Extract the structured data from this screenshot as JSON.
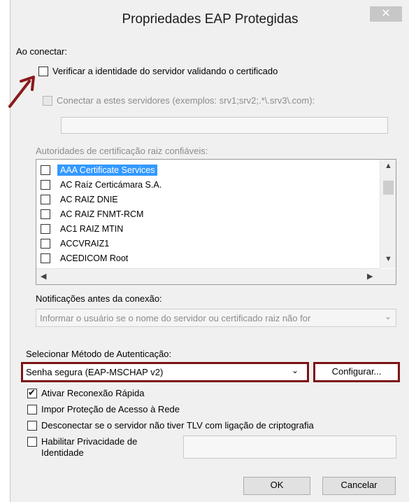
{
  "window": {
    "title": "Propriedades EAP Protegidas",
    "close_glyph": "✕"
  },
  "connect_label": "Ao conectar:",
  "verify_server": {
    "label": "Verificar a identidade do servidor validando o certificado",
    "checked": false
  },
  "connect_servers": {
    "label": "Conectar a estes servidores (exemplos: srv1;srv2;.*\\.srv3\\.com):",
    "checked": false,
    "value": ""
  },
  "trusted_roots": {
    "label": "Autoridades de certificação raiz confiáveis:",
    "items": [
      {
        "label": "AAA Certificate Services",
        "checked": false,
        "selected": true
      },
      {
        "label": "AC Raíz Certicámara S.A.",
        "checked": false,
        "selected": false
      },
      {
        "label": "AC RAIZ DNIE",
        "checked": false,
        "selected": false
      },
      {
        "label": "AC RAIZ FNMT-RCM",
        "checked": false,
        "selected": false
      },
      {
        "label": "AC1 RAIZ MTIN",
        "checked": false,
        "selected": false
      },
      {
        "label": "ACCVRAIZ1",
        "checked": false,
        "selected": false
      },
      {
        "label": "ACEDICOM Root",
        "checked": false,
        "selected": false
      }
    ]
  },
  "notifications": {
    "label": "Notificações antes da conexão:",
    "selected": "Informar o usuário se o nome do servidor ou certificado raiz não for"
  },
  "auth_method": {
    "label": "Selecionar Método de Autenticação:",
    "selected": "Senha segura (EAP-MSCHAP v2)",
    "configure_label": "Configurar..."
  },
  "options": {
    "fast_reconnect": {
      "label": "Ativar Reconexão Rápida",
      "checked": true
    },
    "nap": {
      "label": "Impor Proteção de Acesso à Rede",
      "checked": false
    },
    "tlv": {
      "label": "Desconectar se o servidor não tiver TLV com ligação de criptografia",
      "checked": false
    },
    "identity_privacy": {
      "label_line1": "Habilitar Privacidade de",
      "label_line2": "Identidade",
      "checked": false,
      "value": ""
    }
  },
  "buttons": {
    "ok": "OK",
    "cancel": "Cancelar"
  },
  "colors": {
    "highlight_border": "#7b1416",
    "arrow": "#8b1a1a",
    "selection": "#3399ff"
  }
}
